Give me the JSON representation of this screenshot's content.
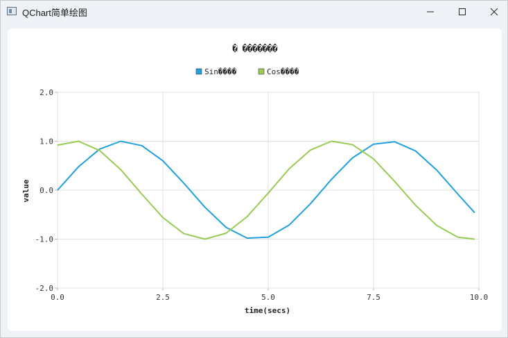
{
  "window": {
    "title": "QChart简单绘图",
    "icons": {
      "app": "app-window-icon",
      "minimize": "minimize-icon",
      "maximize": "maximize-icon",
      "close": "close-icon"
    }
  },
  "chart_data": {
    "type": "line",
    "title": "�  �������",
    "xlabel": "time(secs)",
    "ylabel": "value",
    "xlim": [
      0,
      10
    ],
    "ylim": [
      -2,
      2
    ],
    "xticks": [
      "0.0",
      "2.5",
      "5.0",
      "7.5",
      "10.0"
    ],
    "yticks": [
      "2.0",
      "1.0",
      "0.0",
      "-1.0",
      "-2.0"
    ],
    "grid": true,
    "legend": "top",
    "series": [
      {
        "name": "Sin����",
        "color": "#209fdf",
        "x": [
          0.0,
          0.5,
          1.0,
          1.5,
          2.0,
          2.5,
          3.0,
          3.5,
          4.0,
          4.5,
          5.0,
          5.5,
          6.0,
          6.5,
          7.0,
          7.5,
          8.0,
          8.5,
          9.0,
          9.5,
          9.9
        ],
        "values": [
          0.0,
          0.48,
          0.84,
          1.0,
          0.91,
          0.6,
          0.14,
          -0.35,
          -0.76,
          -0.98,
          -0.96,
          -0.71,
          -0.28,
          0.22,
          0.66,
          0.94,
          0.99,
          0.8,
          0.41,
          -0.08,
          -0.46
        ]
      },
      {
        "name": "Cos����",
        "color": "#99ca53",
        "x": [
          0.0,
          0.5,
          1.0,
          1.5,
          2.0,
          2.5,
          3.0,
          3.5,
          4.0,
          4.5,
          5.0,
          5.5,
          6.0,
          6.5,
          7.0,
          7.5,
          8.0,
          8.5,
          9.0,
          9.5,
          9.9
        ],
        "values": [
          0.92,
          1.0,
          0.81,
          0.42,
          -0.08,
          -0.56,
          -0.89,
          -1.0,
          -0.88,
          -0.54,
          -0.06,
          0.44,
          0.82,
          1.0,
          0.93,
          0.64,
          0.18,
          -0.31,
          -0.72,
          -0.96,
          -1.0
        ]
      }
    ]
  }
}
